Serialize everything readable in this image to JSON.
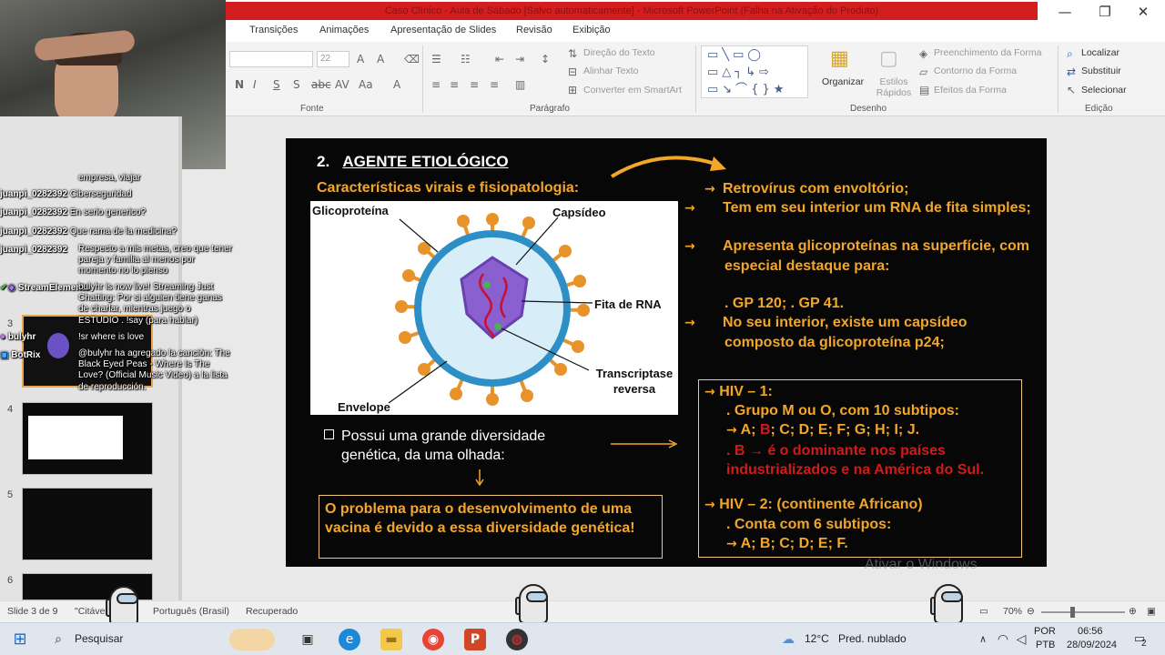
{
  "window": {
    "title": "Caso Clínico - Aula de Sábado [Salvo automaticamente] - Microsoft PowerPoint (Falha na Ativação do Produto)",
    "minimize": "—",
    "maximize": "❐",
    "close": "✕"
  },
  "ribbon": {
    "tabs": [
      "Transições",
      "Animações",
      "Apresentação de Slides",
      "Revisão",
      "Exibição"
    ],
    "font_size": "22",
    "groups": {
      "fonte": "Fonte",
      "paragrafo": "Parágrafo",
      "desenho": "Desenho",
      "edicao": "Edição"
    },
    "direcao_texto": "Direção do Texto",
    "alinhar_texto": "Alinhar Texto",
    "converter_smartart": "Converter em SmartArt",
    "organizar": "Organizar",
    "estilos_rapidos": "Estilos Rápidos",
    "preenchimento_forma": "Preenchimento da Forma",
    "contorno_forma": "Contorno da Forma",
    "efeitos_forma": "Efeitos da Forma",
    "localizar": "Localizar",
    "substituir": "Substituir",
    "selecionar": "Selecionar"
  },
  "thumbnails": {
    "numbers": [
      "3",
      "4",
      "5",
      "6"
    ]
  },
  "chat": [
    {
      "user": "",
      "msg": "empresa, viajar"
    },
    {
      "user": "juanpi_0282392",
      "msg": "Ciberseguridad"
    },
    {
      "user": "juanpi_0282392",
      "msg": "En serio generico?"
    },
    {
      "user": "juanpi_0282392",
      "msg": "Que rama de la medicina?"
    },
    {
      "user": "juanpi_0282392",
      "msg": "Respecto a mis metas, creo que tener pareja y familia al menos por momento no lo pienso"
    },
    {
      "user": "StreamElements",
      "msg": "bulyhr is now live! Streaming Just Chatting: Por si alguien tiene ganas de charlar, mientras juego o ESTUDIO . !say (para hablar)"
    },
    {
      "user": "bulyhr",
      "msg": "!sr where is love"
    },
    {
      "user": "BotRix",
      "msg": "@bulyhr ha agregado la canción: The Black Eyed Peas - Where Is The Love? (Official Music Video) a la lista de reproducción."
    }
  ],
  "slide": {
    "title_num": "2.",
    "title": "AGENTE ETIOLÓGICO",
    "subtitle": "Características virais e fisiopatologia:",
    "virus_labels": {
      "glicoproteina": "Glicoproteína",
      "capsideo": "Capsídeo",
      "fita_rna": "Fita de RNA",
      "transcriptase": "Transcriptase reversa",
      "envelope": "Envelope"
    },
    "bullets": [
      "Retrovírus com envoltório;",
      "Tem em seu interior um RNA de fita simples;",
      "Apresenta glicoproteínas na superfície, com especial destaque para:",
      ". GP 120; . GP 41.",
      "No seu interior, existe um capsídeo composto da glicoproteína p24;"
    ],
    "diversity": "Possui uma grande diversidade genética, da uma olhada:",
    "problem": "O problema para o desenvolvimento de uma vacina é devido a essa diversidade genética!",
    "hiv1_title": "HIV – 1:",
    "hiv1_group": ". Grupo M ou O, com 10 subtipos:",
    "hiv1_subtypes_a": "A;",
    "hiv1_subtypes_b": "B",
    "hiv1_subtypes_rest": "; C; D; E; F; G; H; I; J.",
    "hiv1_dominant": ". B → é o dominante nos países industrializados e na América do Sul.",
    "hiv2_title": "HIV – 2: (continente Africano)",
    "hiv2_count": ". Conta com 6 subtipos:",
    "hiv2_subtypes": "A; B; C; D; E; F."
  },
  "statusbar": {
    "slide": "Slide 3 de 9",
    "theme": "\"Citáve",
    "language": "Português (Brasil)",
    "recovered": "Recuperado",
    "zoom": "70%",
    "watermark": "Ativar o Windows"
  },
  "taskbar": {
    "search": "Pesquisar",
    "weather_temp": "12°C",
    "weather_desc": "Pred. nublado",
    "lang1": "POR",
    "lang2": "PTB",
    "time": "06:56",
    "date": "28/09/2024",
    "notifications": "2"
  },
  "colors": {
    "accent_orange": "#f2a62a",
    "red": "#d11b1b",
    "title_bar_red": "#d21e1e"
  }
}
